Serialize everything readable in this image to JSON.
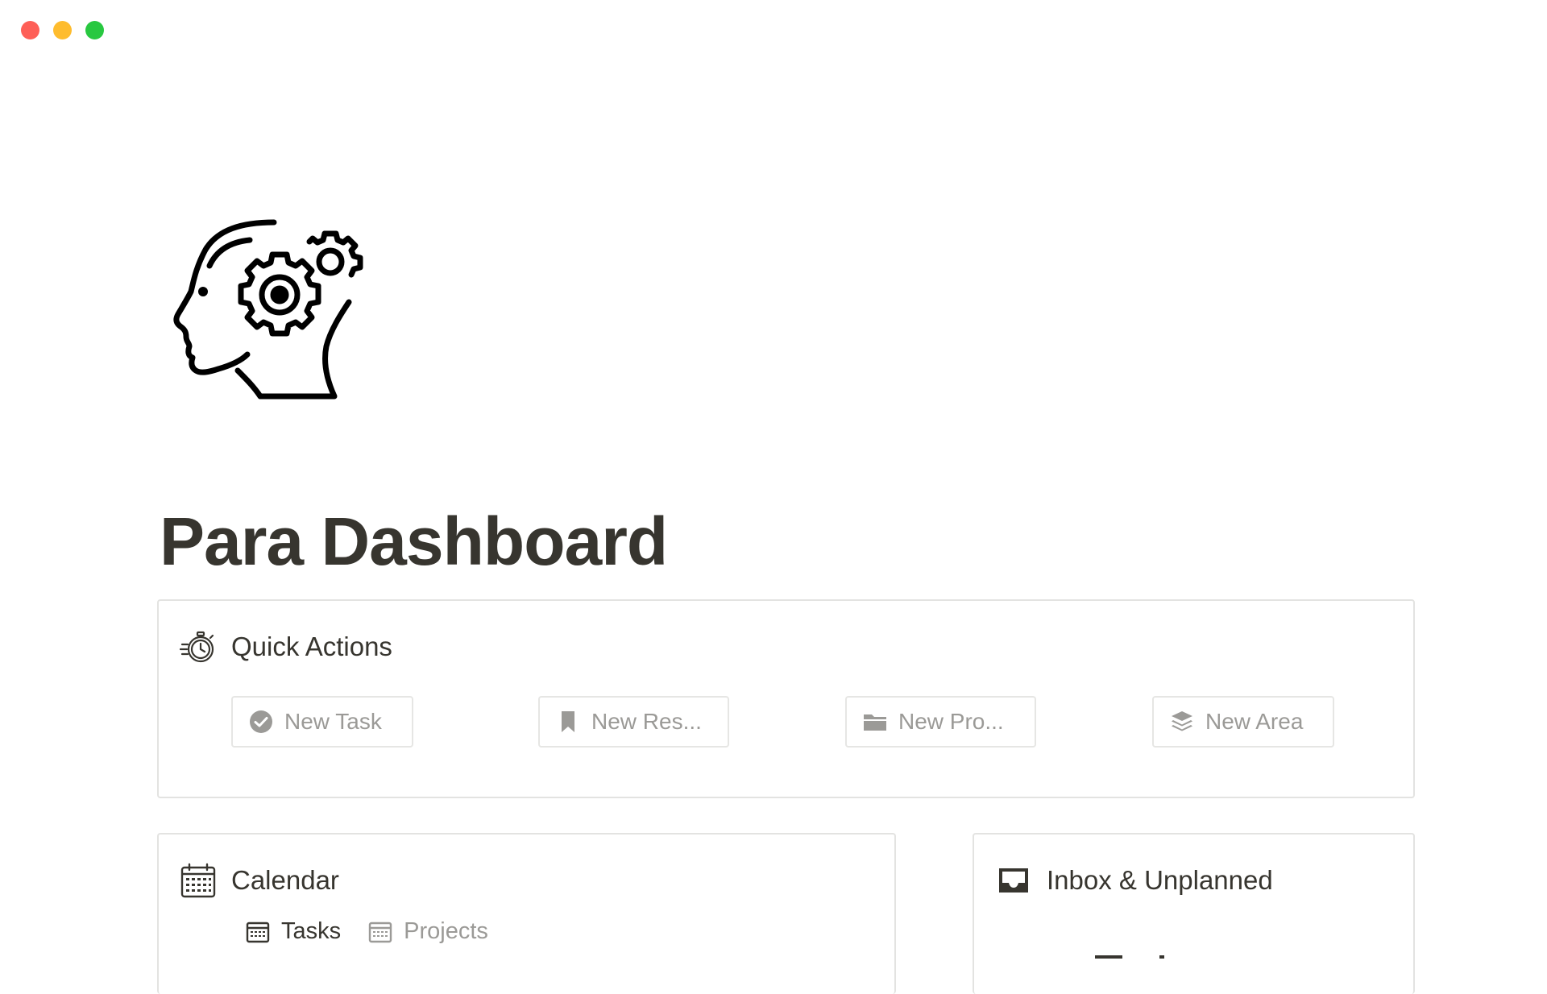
{
  "window": {
    "controls": [
      "close",
      "minimize",
      "zoom"
    ]
  },
  "page": {
    "icon": "head-gears-icon",
    "title": "Para Dashboard"
  },
  "quick_actions": {
    "title": "Quick Actions",
    "icon": "stopwatch-icon",
    "buttons": [
      {
        "label": "New Task",
        "icon": "check-circle-icon"
      },
      {
        "label": "New Res...",
        "icon": "bookmark-icon"
      },
      {
        "label": "New Pro...",
        "icon": "folder-icon"
      },
      {
        "label": "New Area",
        "icon": "layers-icon"
      }
    ]
  },
  "calendar": {
    "title": "Calendar",
    "icon": "calendar-icon",
    "tabs": [
      {
        "label": "Tasks",
        "icon": "calendar-view-icon",
        "active": true
      },
      {
        "label": "Projects",
        "icon": "calendar-view-icon",
        "active": false
      }
    ]
  },
  "inbox": {
    "title": "Inbox & Unplanned",
    "icon": "inbox-tray-icon"
  },
  "colors": {
    "text": "#37352f",
    "muted": "#9b9a97",
    "border": "#e3e3e1",
    "close": "#fe5f57",
    "minimize": "#febc2e",
    "zoom": "#28c840"
  }
}
